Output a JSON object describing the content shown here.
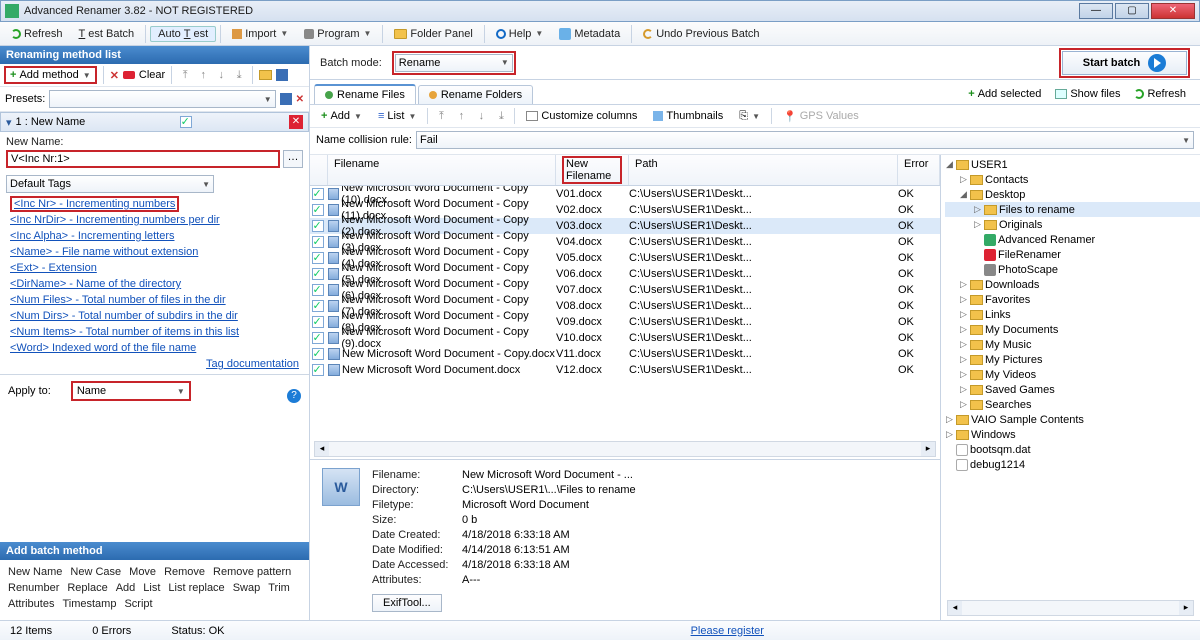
{
  "title": "Advanced Renamer 3.82 - NOT REGISTERED",
  "toolbar": {
    "refresh": "Refresh",
    "test_batch": "Test Batch",
    "auto_test": "Auto Test",
    "import": "Import",
    "program": "Program",
    "folder_panel": "Folder Panel",
    "help": "Help",
    "metadata": "Metadata",
    "undo": "Undo Previous Batch"
  },
  "left": {
    "header": "Renaming method list",
    "add_method": "Add method",
    "clear": "Clear",
    "presets_label": "Presets:",
    "method_title": "1 : New Name",
    "new_name_label": "New Name:",
    "new_name_value": "V<Inc Nr:1>",
    "default_tags": "Default Tags",
    "tags": [
      "<Inc Nr> - Incrementing numbers",
      "<Inc NrDir> - Incrementing numbers per dir",
      "<Inc Alpha> - Incrementing letters",
      "<Name> - File name without extension",
      "<Ext> - Extension",
      "<DirName> - Name of the directory",
      "<Num Files> - Total number of files in the dir",
      "<Num Dirs> - Total number of subdirs in the dir",
      "<Num Items> - Total number of items in this list",
      "<Word> Indexed word of the file name"
    ],
    "tag_doc": "Tag documentation",
    "apply_to_label": "Apply to:",
    "apply_to_value": "Name",
    "add_batch_header": "Add batch method",
    "batch_rows": [
      [
        "New Name",
        "New Case",
        "Move",
        "Remove",
        "Remove pattern"
      ],
      [
        "Renumber",
        "Replace",
        "Add",
        "List",
        "List replace",
        "Swap",
        "Trim"
      ],
      [
        "Attributes",
        "Timestamp",
        "Script"
      ]
    ]
  },
  "center": {
    "batch_mode_label": "Batch mode:",
    "batch_mode_value": "Rename",
    "start_batch": "Start batch",
    "tab_files": "Rename Files",
    "tab_folders": "Rename Folders",
    "add_selected": "Add selected",
    "show_files": "Show files",
    "refresh": "Refresh",
    "fbar_add": "Add",
    "fbar_list": "List",
    "fbar_custcols": "Customize columns",
    "fbar_thumbs": "Thumbnails",
    "fbar_gps": "GPS Values",
    "coll_label": "Name collision rule:",
    "coll_value": "Fail",
    "cols": {
      "fn": "Filename",
      "nf": "New Filename",
      "path": "Path",
      "err": "Error"
    },
    "rows": [
      {
        "fn": "New Microsoft Word Document - Copy (10).docx",
        "nf": "V01.docx",
        "path": "C:\\Users\\USER1\\Deskt...",
        "err": "OK"
      },
      {
        "fn": "New Microsoft Word Document - Copy (11).docx",
        "nf": "V02.docx",
        "path": "C:\\Users\\USER1\\Deskt...",
        "err": "OK"
      },
      {
        "fn": "New Microsoft Word Document - Copy (2).docx",
        "nf": "V03.docx",
        "path": "C:\\Users\\USER1\\Deskt...",
        "err": "OK",
        "sel": true
      },
      {
        "fn": "New Microsoft Word Document - Copy (3).docx",
        "nf": "V04.docx",
        "path": "C:\\Users\\USER1\\Deskt...",
        "err": "OK"
      },
      {
        "fn": "New Microsoft Word Document - Copy (4).docx",
        "nf": "V05.docx",
        "path": "C:\\Users\\USER1\\Deskt...",
        "err": "OK"
      },
      {
        "fn": "New Microsoft Word Document - Copy (5).docx",
        "nf": "V06.docx",
        "path": "C:\\Users\\USER1\\Deskt...",
        "err": "OK"
      },
      {
        "fn": "New Microsoft Word Document - Copy (6).docx",
        "nf": "V07.docx",
        "path": "C:\\Users\\USER1\\Deskt...",
        "err": "OK"
      },
      {
        "fn": "New Microsoft Word Document - Copy (7).docx",
        "nf": "V08.docx",
        "path": "C:\\Users\\USER1\\Deskt...",
        "err": "OK"
      },
      {
        "fn": "New Microsoft Word Document - Copy (8).docx",
        "nf": "V09.docx",
        "path": "C:\\Users\\USER1\\Deskt...",
        "err": "OK"
      },
      {
        "fn": "New Microsoft Word Document - Copy (9).docx",
        "nf": "V10.docx",
        "path": "C:\\Users\\USER1\\Deskt...",
        "err": "OK"
      },
      {
        "fn": "New Microsoft Word Document - Copy.docx",
        "nf": "V11.docx",
        "path": "C:\\Users\\USER1\\Deskt...",
        "err": "OK"
      },
      {
        "fn": "New Microsoft Word Document.docx",
        "nf": "V12.docx",
        "path": "C:\\Users\\USER1\\Deskt...",
        "err": "OK"
      }
    ],
    "details": {
      "Filename": "New Microsoft Word Document - ...",
      "Directory": "C:\\Users\\USER1\\...\\Files to rename",
      "Filetype": "Microsoft Word Document",
      "Size": "0 b",
      "Date_Created": "4/18/2018 6:33:18 AM",
      "Date_Modified": "4/14/2018 6:13:51 AM",
      "Date_Accessed": "4/18/2018 6:33:18 AM",
      "Attributes": "A---"
    },
    "detail_labels": {
      "Filename": "Filename:",
      "Directory": "Directory:",
      "Filetype": "Filetype:",
      "Size": "Size:",
      "Date_Created": "Date Created:",
      "Date_Modified": "Date Modified:",
      "Date_Accessed": "Date Accessed:",
      "Attributes": "Attributes:"
    },
    "exif_btn": "ExifTool..."
  },
  "tree": [
    {
      "ind": 0,
      "tw": "◢",
      "icon": "folder",
      "label": "USER1"
    },
    {
      "ind": 1,
      "tw": "▷",
      "icon": "folder",
      "label": "Contacts"
    },
    {
      "ind": 1,
      "tw": "◢",
      "icon": "folder",
      "label": "Desktop"
    },
    {
      "ind": 2,
      "tw": "▷",
      "icon": "folder",
      "label": "Files to rename",
      "sel": true
    },
    {
      "ind": 2,
      "tw": "▷",
      "icon": "folder",
      "label": "Originals"
    },
    {
      "ind": 2,
      "tw": "",
      "icon": "a",
      "label": "Advanced Renamer"
    },
    {
      "ind": 2,
      "tw": "",
      "icon": "r",
      "label": "FileRenamer"
    },
    {
      "ind": 2,
      "tw": "",
      "icon": "p",
      "label": "PhotoScape"
    },
    {
      "ind": 1,
      "tw": "▷",
      "icon": "folder",
      "label": "Downloads"
    },
    {
      "ind": 1,
      "tw": "▷",
      "icon": "folder",
      "label": "Favorites"
    },
    {
      "ind": 1,
      "tw": "▷",
      "icon": "folder",
      "label": "Links"
    },
    {
      "ind": 1,
      "tw": "▷",
      "icon": "folder",
      "label": "My Documents"
    },
    {
      "ind": 1,
      "tw": "▷",
      "icon": "folder",
      "label": "My Music"
    },
    {
      "ind": 1,
      "tw": "▷",
      "icon": "folder",
      "label": "My Pictures"
    },
    {
      "ind": 1,
      "tw": "▷",
      "icon": "folder",
      "label": "My Videos"
    },
    {
      "ind": 1,
      "tw": "▷",
      "icon": "folder",
      "label": "Saved Games"
    },
    {
      "ind": 1,
      "tw": "▷",
      "icon": "folder",
      "label": "Searches"
    },
    {
      "ind": 0,
      "tw": "▷",
      "icon": "folder",
      "label": "VAIO Sample Contents"
    },
    {
      "ind": 0,
      "tw": "▷",
      "icon": "folder",
      "label": "Windows"
    },
    {
      "ind": 0,
      "tw": "",
      "icon": "fi",
      "label": "bootsqm.dat"
    },
    {
      "ind": 0,
      "tw": "",
      "icon": "fi",
      "label": "debug1214"
    }
  ],
  "status": {
    "items": "12 Items",
    "errors": "0 Errors",
    "ok": "Status: OK",
    "register": "Please register"
  }
}
